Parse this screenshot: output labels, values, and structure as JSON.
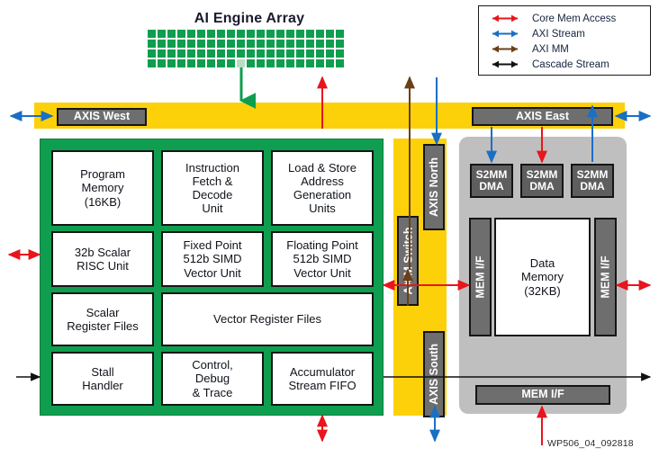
{
  "diagram": {
    "title": "AI Engine Array",
    "doc_code": "WP506_04_092818"
  },
  "legend": {
    "items": [
      {
        "label": "Core Mem Access",
        "color": "#e8151c",
        "icon": "double-arrow-icon"
      },
      {
        "label": "AXI Stream",
        "color": "#1a6fc4",
        "icon": "double-arrow-icon"
      },
      {
        "label": "AXI MM",
        "color": "#6b3f16",
        "icon": "double-arrow-icon"
      },
      {
        "label": "Cascade Stream",
        "color": "#111111",
        "icon": "double-arrow-icon"
      }
    ]
  },
  "bus": {
    "west_label": "AXIS West",
    "east_label": "AXIS East"
  },
  "core": {
    "blocks": [
      {
        "label": "Program Memory (16KB)",
        "lines": [
          "Program",
          "Memory",
          "(16KB)"
        ]
      },
      {
        "label": "Instruction Fetch & Decode Unit",
        "lines": [
          "Instruction",
          "Fetch &",
          "Decode",
          "Unit"
        ]
      },
      {
        "label": "Load & Store Address Generation Units",
        "lines": [
          "Load & Store",
          "Address",
          "Generation",
          "Units"
        ]
      },
      {
        "label": "32b Scalar RISC Unit",
        "lines": [
          "32b Scalar",
          "RISC Unit"
        ]
      },
      {
        "label": "Fixed Point 512b SIMD Vector Unit",
        "lines": [
          "Fixed Point",
          "512b SIMD",
          "Vector Unit"
        ]
      },
      {
        "label": "Floating Point 512b SIMD Vector Unit",
        "lines": [
          "Floating Point",
          "512b SIMD",
          "Vector Unit"
        ]
      },
      {
        "label": "Scalar Register Files",
        "lines": [
          "Scalar",
          "Register Files"
        ]
      },
      {
        "label": "Vector Register Files",
        "lines": [
          "Vector Register Files"
        ]
      },
      {
        "label": "Stall Handler",
        "lines": [
          "Stall",
          "Handler"
        ]
      },
      {
        "label": "Control, Debug & Trace",
        "lines": [
          "Control,",
          "Debug",
          "& Trace"
        ]
      },
      {
        "label": "Accumulator Stream FIFO",
        "lines": [
          "Accumulator",
          "Stream FIFO"
        ]
      }
    ]
  },
  "switch_column": {
    "axim_switch": "AXIM Switch",
    "axis_north": "AXIS North",
    "axis_south": "AXIS South"
  },
  "memory": {
    "dma": [
      "S2MM DMA",
      "S2MM DMA",
      "S2MM DMA"
    ],
    "dma_lines": [
      [
        "S2MM",
        "DMA"
      ],
      [
        "S2MM",
        "DMA"
      ],
      [
        "S2MM",
        "DMA"
      ]
    ],
    "mem_if_left": "MEM I/F",
    "mem_if_right": "MEM I/F",
    "mem_if_bottom": "MEM I/F",
    "data_memory": {
      "lines": [
        "Data",
        "Memory",
        "(32KB)"
      ],
      "label": "Data Memory (32KB)"
    }
  },
  "colors": {
    "green": "#0f9e4f",
    "yellow": "#fcd10a",
    "panel_gray": "#bfbfbf",
    "box_gray": "#6e6e6e",
    "red": "#e8151c",
    "blue": "#1a6fc4",
    "brown": "#6b3f16",
    "black": "#111111"
  },
  "array": {
    "rows": 4,
    "cols": 20,
    "highlight": {
      "row": 3,
      "col": 9
    }
  }
}
